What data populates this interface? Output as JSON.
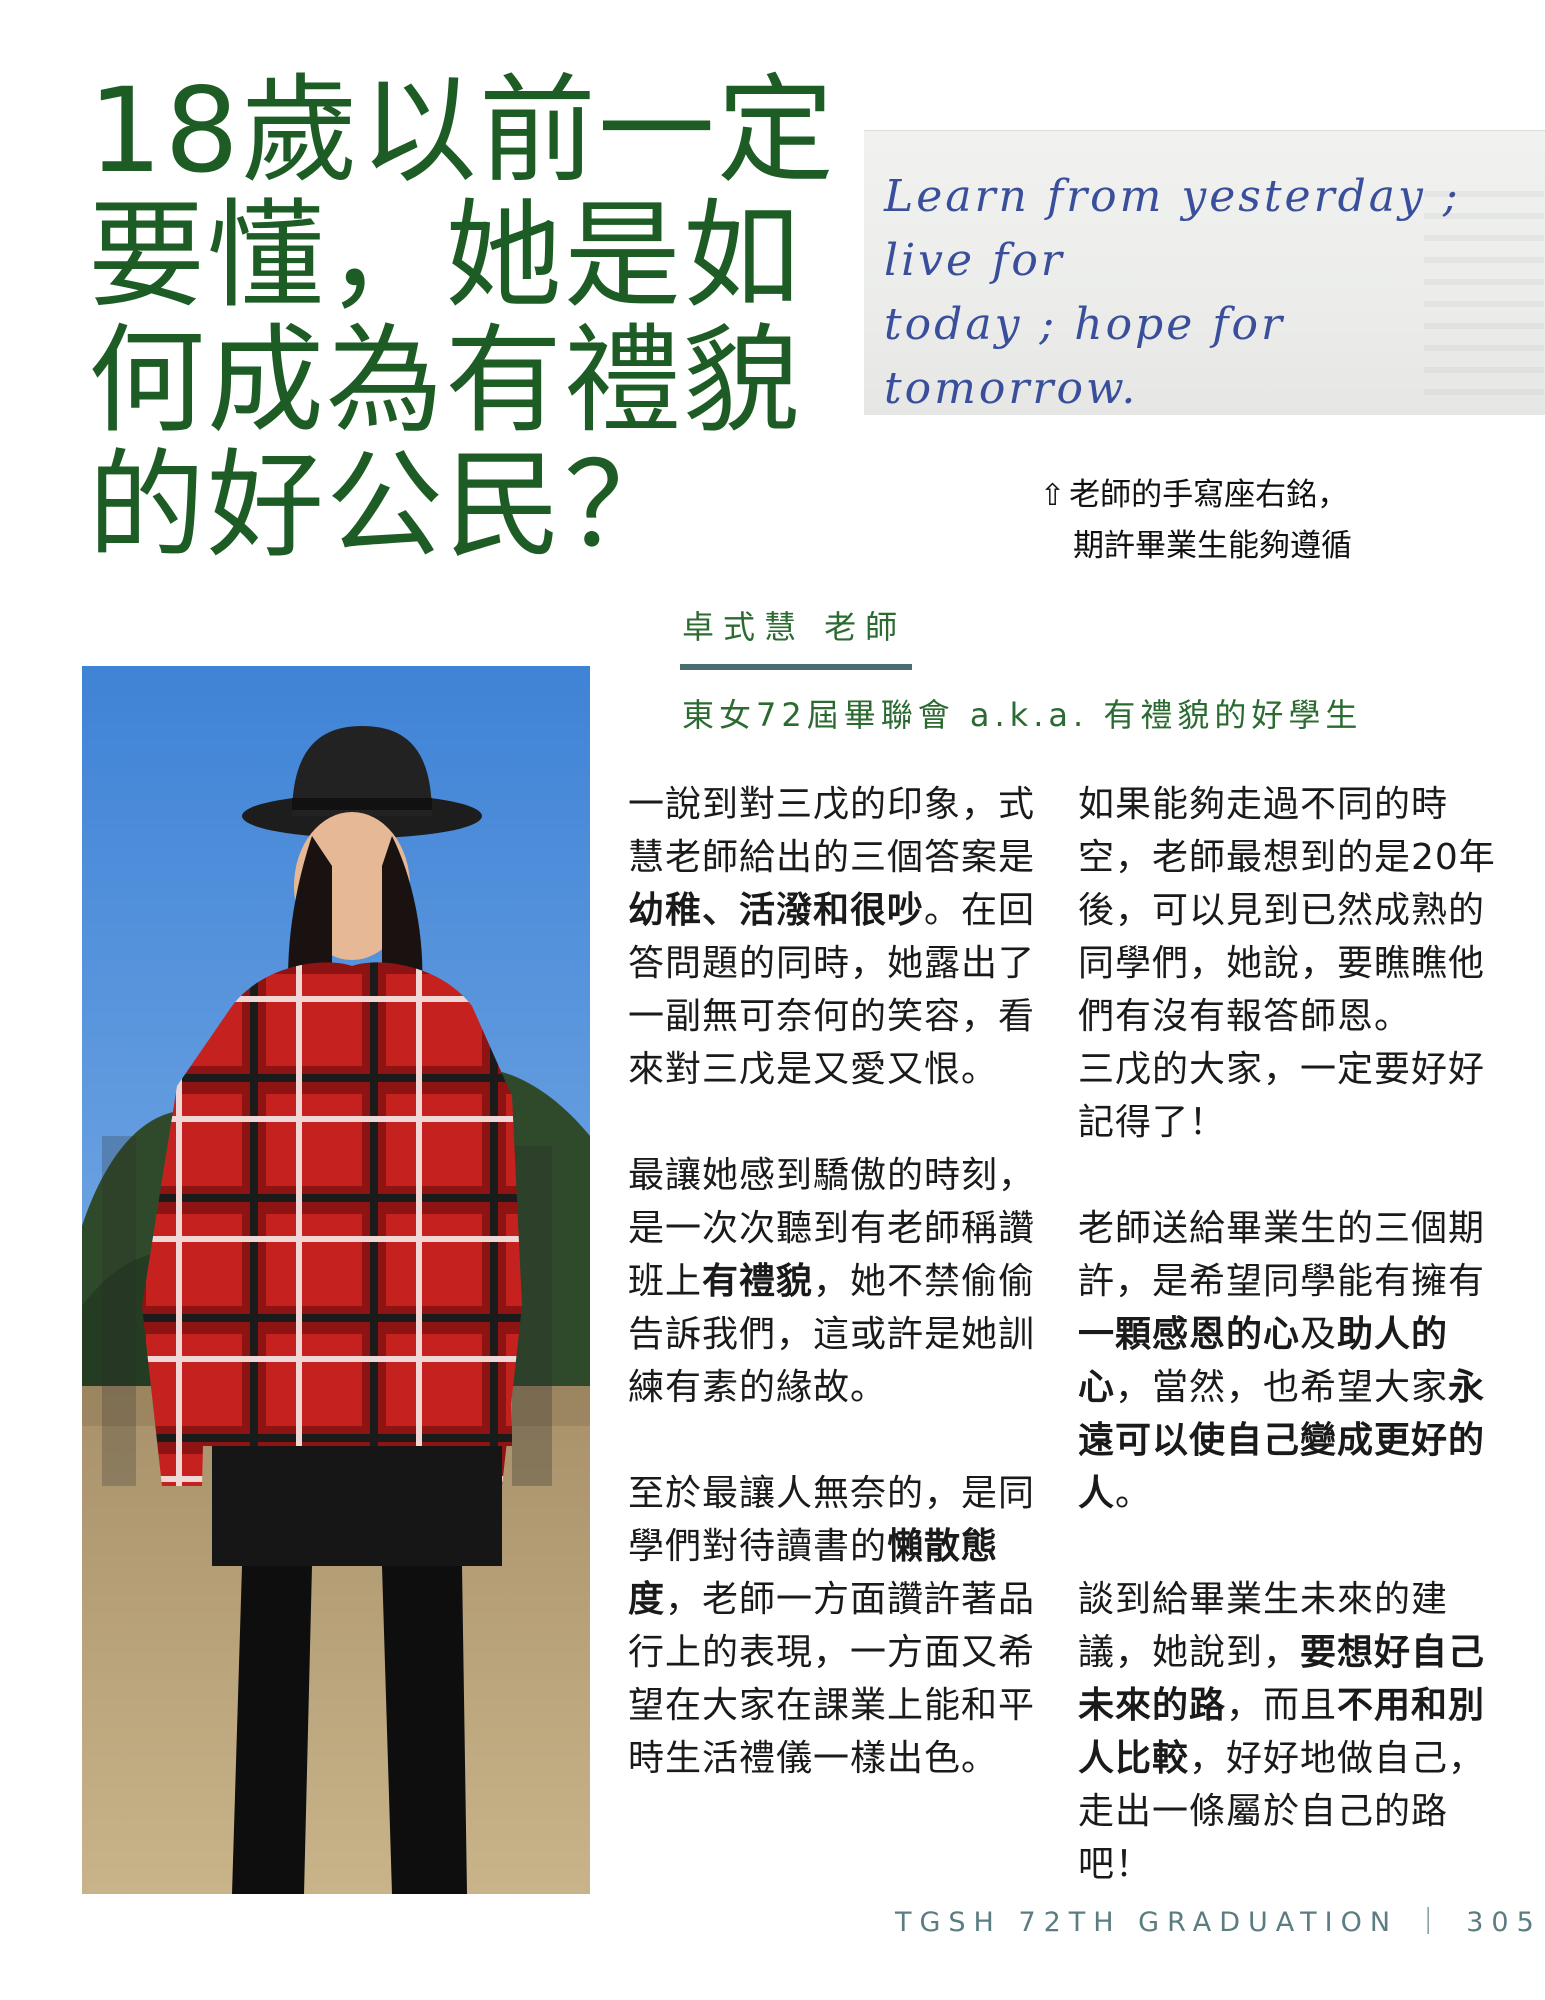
{
  "title": "18歲以前一定要懂，她是如何成為有禮貌的好公民？",
  "handwritten_note": {
    "line1": "Learn from yesterday ; live for",
    "line2": "today ; hope for tomorrow."
  },
  "caption": {
    "arrow": "⇧",
    "line1": "老師的手寫座右銘，",
    "line2": "期許畢業生能夠遵循"
  },
  "byline": "卓式慧 老師",
  "subtitle": "東女72屆畢聯會 a.k.a. 有禮貌的好學生",
  "col1": {
    "p1": {
      "a": "一說到對三戊的印象，式慧老師給出的三個答案是",
      "b": "幼稚、活潑和很吵",
      "c": "。在回答問題的同時，她露出了一副無可奈何的笑容，看來對三戊是又愛又恨。"
    },
    "p2": {
      "a": "最讓她感到驕傲的時刻，是一次次聽到有老師稱讚班上",
      "b": "有禮貌",
      "c": "，她不禁偷偷告訴我們，這或許是她訓練有素的緣故。"
    },
    "p3": {
      "a": "至於最讓人無奈的，是同學們對待讀書的",
      "b": "懶散態度",
      "c": "，老師一方面讚許著品行上的表現，一方面又希望在大家在課業上能和平時生活禮儀一樣出色。"
    }
  },
  "col2": {
    "p1": "如果能夠走過不同的時空，老師最想到的是20年後，可以見到已然成熟的同學們，她說，要瞧瞧他們有沒有報答師恩。",
    "p1b": "三戊的大家，一定要好好記得了！",
    "p2": {
      "a": "老師送給畢業生的三個期許，是希望同學能有擁有",
      "b": "一顆感恩的心",
      "c": "及",
      "d": "助人的心",
      "e": "，當然，也希望大家",
      "f": "永遠可以使自己變成更好的人",
      "g": "。"
    },
    "p3": {
      "a": "談到給畢業生未來的建議，她說到，",
      "b": "要想好自己未來的路",
      "c": "，而且",
      "d": "不用和別人比較",
      "e": "，好好地做自己，走出一條屬於自己的路吧！"
    }
  },
  "footer": "TGSH 72TH GRADUATION ｜ 305",
  "colors": {
    "title": "#1d5c24",
    "accent_text": "#2b6a30",
    "rule": "#4a6d72",
    "footer": "#5b7d82",
    "handwriting_ink": "#3a4f9c"
  }
}
